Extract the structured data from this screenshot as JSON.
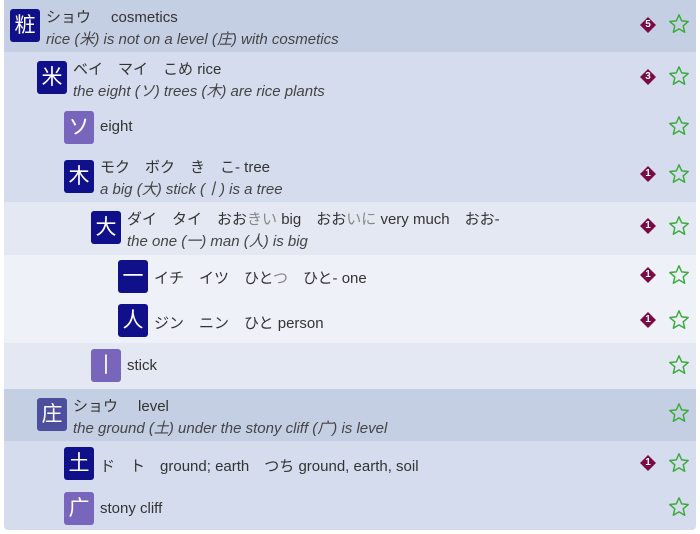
{
  "colors": {
    "row_dark": "#c5cfe4",
    "row_mid": "#d4dced",
    "row_light": "#e3e8f3",
    "row_lighter": "#eef1f8",
    "badge": "#7a0a44",
    "star": "#3caa3c",
    "kanji_dark": "#10118a",
    "kanji_purple": "#7766bb"
  },
  "rows": [
    {
      "kanji": "粧",
      "readings": "ショウ",
      "meaning": "cosmetics",
      "mnemonic": "rice (米) is not on a level (庄) with cosmetics",
      "badge": "5",
      "star": "☆"
    },
    {
      "kanji": "米",
      "readings": "ベイ　マイ　こめ",
      "meaning": "rice",
      "mnemonic": "the eight (ソ) trees (木) are rice plants",
      "badge": "3",
      "star": "☆"
    },
    {
      "kanji": "ソ",
      "readings": "",
      "meaning": "eight",
      "mnemonic": "",
      "badge": "",
      "star": "☆"
    },
    {
      "kanji": "木",
      "readings": "モク　ボク　き　こ-",
      "meaning": "tree",
      "mnemonic": "a big (大) stick (丨) is a tree",
      "badge": "1",
      "star": "☆"
    },
    {
      "kanji": "大",
      "readings_a": "ダイ　タイ　おお",
      "readings_a_faded": "きい",
      "meaning_a": "big",
      "readings_b": "おお",
      "readings_b_faded": "いに",
      "meaning_b": "very much",
      "readings_c": "おお-",
      "mnemonic": "the one (一) man (人) is big",
      "badge": "1",
      "star": "☆"
    },
    {
      "kanji": "一",
      "readings": "イチ　イツ　ひと",
      "readings_faded": "つ",
      "readings_2": "ひと-",
      "meaning": "one",
      "badge": "1",
      "star": "☆"
    },
    {
      "kanji": "人",
      "readings": "ジン　ニン　ひと",
      "meaning": "person",
      "badge": "1",
      "star": "☆"
    },
    {
      "kanji": "丨",
      "readings": "",
      "meaning": "stick",
      "badge": "",
      "star": "☆"
    },
    {
      "kanji": "庄",
      "readings": "ショウ",
      "meaning": "level",
      "mnemonic": "the ground (土) under the stony cliff (广) is level",
      "badge": "",
      "star": "☆"
    },
    {
      "kanji": "土",
      "readings": "ド　ト",
      "meaning": "ground; earth",
      "readings_2": "つち",
      "meaning_2": "ground, earth, soil",
      "badge": "1",
      "star": "☆"
    },
    {
      "kanji": "广",
      "readings": "",
      "meaning": "stony cliff",
      "badge": "",
      "star": "☆"
    }
  ]
}
